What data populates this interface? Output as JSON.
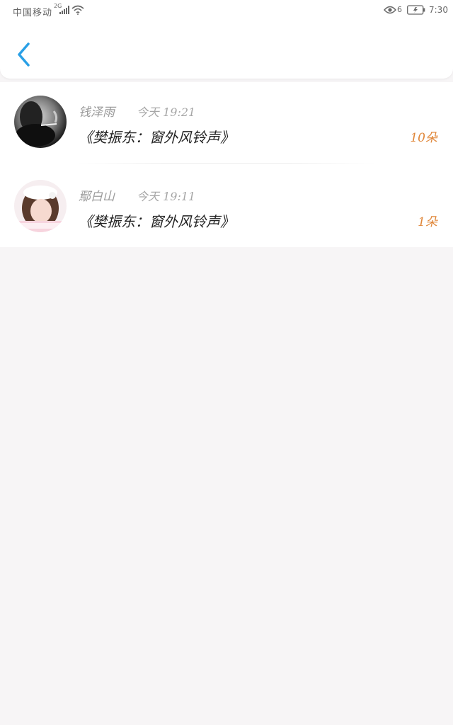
{
  "status_bar": {
    "carrier": "中国移动",
    "network": "2G",
    "battery_percent": "6",
    "time": "7:30"
  },
  "header": {
    "back_icon": "chevron-left-icon",
    "accent_color": "#2aa0e6"
  },
  "messages": [
    {
      "name": "钱泽雨",
      "time": "今天 19:21",
      "title": "《樊振东：窗外风铃声》",
      "count": "10朵"
    },
    {
      "name": "鄢白山",
      "time": "今天 19:11",
      "title": "《樊振东：窗外风铃声》",
      "count": "1朵"
    }
  ],
  "colors": {
    "count": "#e0873a",
    "background": "#f7f5f6"
  }
}
